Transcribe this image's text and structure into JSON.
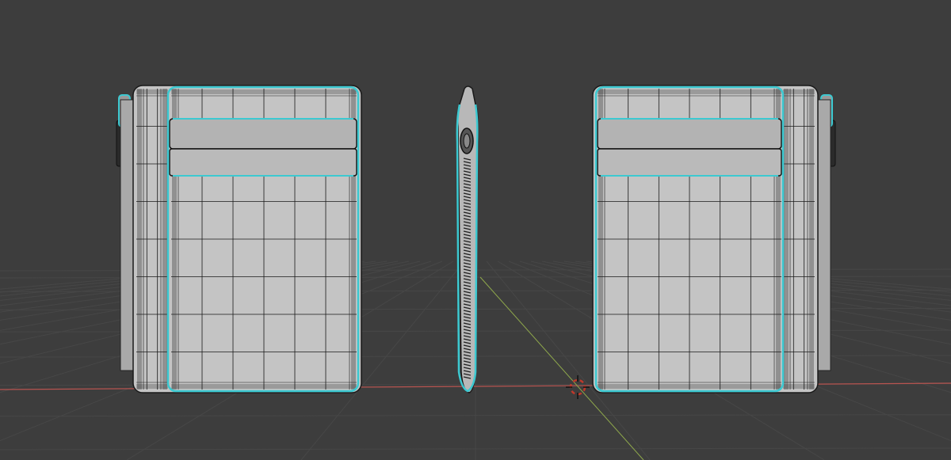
{
  "viewport": {
    "background": "#3d3d3d",
    "grid_color": "#474747",
    "x_axis_color": "#b85450",
    "y_axis_color": "#8fa84c",
    "cursor_colors": [
      "#ffffff",
      "#c0392b"
    ]
  },
  "objects": [
    {
      "name": "wallet-front-view",
      "selection_outline": "#3cc9d1"
    },
    {
      "name": "wallet-side-view",
      "selection_outline": "#3cc9d1"
    },
    {
      "name": "wallet-back-view",
      "selection_outline": "#3cc9d1"
    }
  ],
  "materials": {
    "body": "#bfbfbf",
    "wire": "#1a1a1a",
    "selection": "#3cc9d1"
  },
  "icons": [
    "3d-cursor-icon"
  ]
}
